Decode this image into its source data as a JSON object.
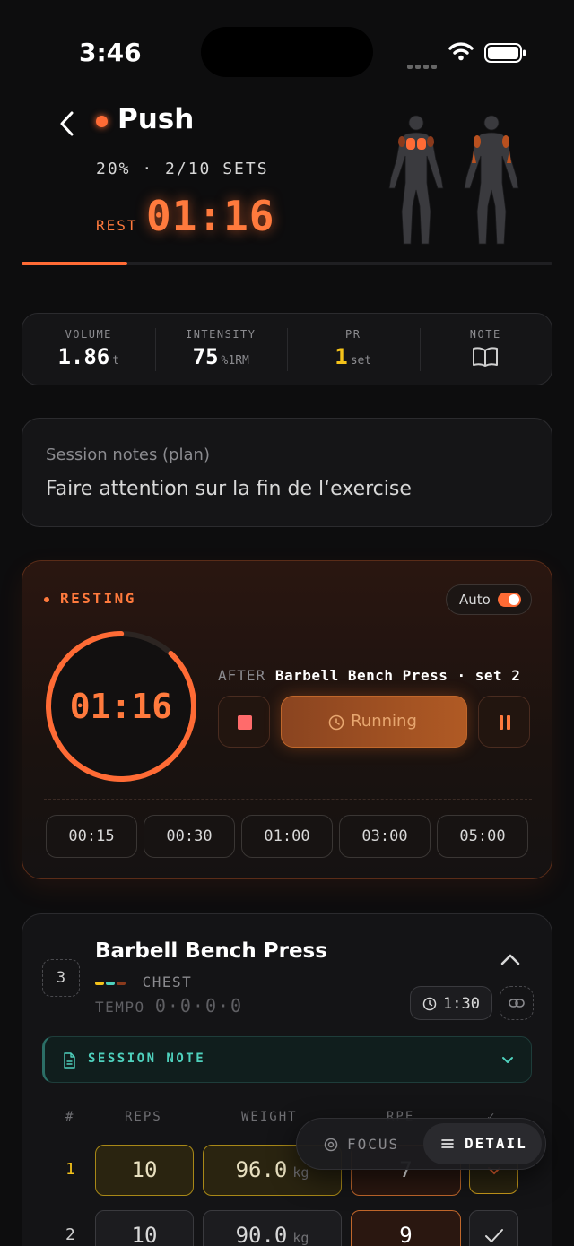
{
  "status": {
    "time": "3:46"
  },
  "header": {
    "title": "Push",
    "progress": "20% · 2/10 SETS",
    "progress_fraction": 0.2,
    "rest_label": "REST",
    "rest_time": "01:16"
  },
  "stats": [
    {
      "label": "VOLUME",
      "value": "1.86",
      "unit": "t"
    },
    {
      "label": "INTENSITY",
      "value": "75",
      "unit": "%1RM"
    },
    {
      "label": "PR",
      "value": "1",
      "unit": "set"
    },
    {
      "label": "NOTE",
      "icon": "book-icon"
    }
  ],
  "notes": {
    "label": "Session notes (plan)",
    "text": "Faire attention sur la fin de l‘exercise"
  },
  "rest": {
    "status": "RESTING",
    "auto_label": "Auto",
    "time": "01:16",
    "ring_fraction": 0.88,
    "after_label": "AFTER",
    "after_exercise": "Barbell Bench Press · set 2",
    "running_label": "Running",
    "presets": [
      "00:15",
      "00:30",
      "01:00",
      "03:00",
      "05:00"
    ]
  },
  "exercise": {
    "number": "3",
    "name": "Barbell Bench Press",
    "muscle": "CHEST",
    "tempo_label": "TEMPO",
    "tempo": "0·0·0·0",
    "rest_time": "1:30",
    "session_note_label": "SESSION NOTE",
    "columns": {
      "num": "#",
      "reps": "REPS",
      "weight": "WEIGHT",
      "rpe": "RPE"
    },
    "sets": [
      {
        "num": "1",
        "reps": "10",
        "weight": "96.0",
        "unit": "kg",
        "rpe": "7"
      },
      {
        "num": "2",
        "reps": "10",
        "weight": "90.0",
        "unit": "kg",
        "rpe": "9"
      }
    ]
  },
  "mode": {
    "focus": "FOCUS",
    "detail": "DETAIL"
  },
  "colors": {
    "accent": "#ff6b35",
    "gold": "#f4c21a",
    "teal": "#4fd1bd"
  }
}
